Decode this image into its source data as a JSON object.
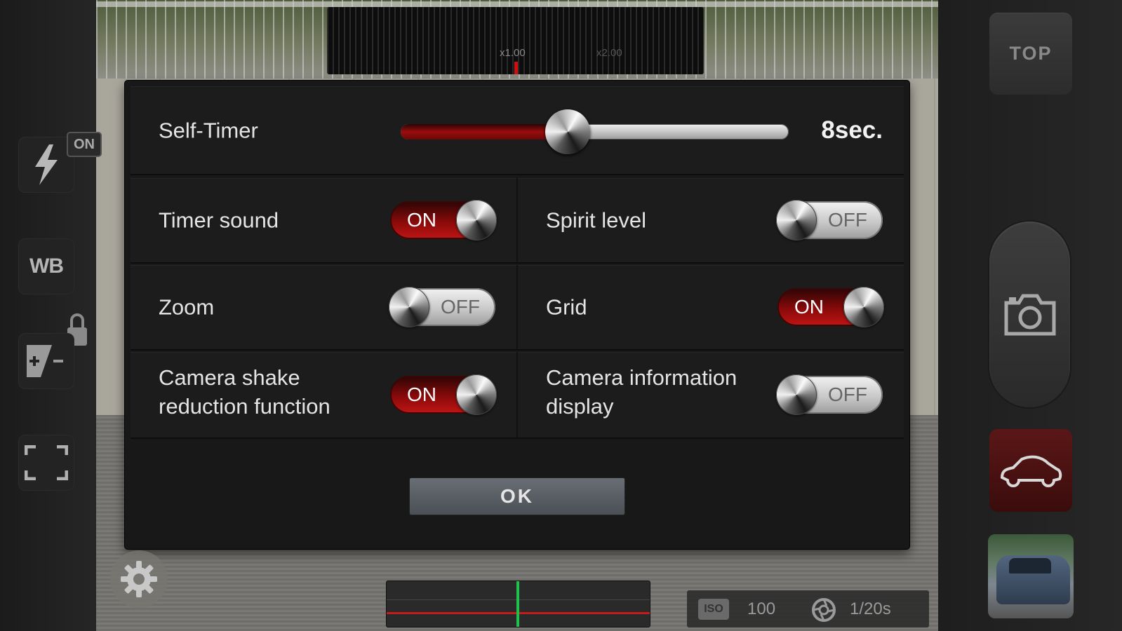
{
  "viewfinder": {
    "zoom_labels": [
      "x1.00",
      "x2.00"
    ]
  },
  "left_toolbar": {
    "flash_badge": "ON",
    "wb_label": "WB"
  },
  "right_toolbar": {
    "top_label": "TOP"
  },
  "settings": {
    "self_timer": {
      "label": "Self-Timer",
      "value_text": "8sec.",
      "level": 0.43
    },
    "toggles": [
      {
        "label": "Timer sound",
        "state": "ON"
      },
      {
        "label": "Spirit level",
        "state": "OFF"
      },
      {
        "label": "Zoom",
        "state": "OFF"
      },
      {
        "label": "Grid",
        "state": "ON"
      },
      {
        "label_line1": "Camera shake",
        "label_line2": "reduction function",
        "state": "ON"
      },
      {
        "label_line1": "Camera information",
        "label_line2": "display",
        "state": "OFF"
      }
    ],
    "ok_label": "OK"
  },
  "hud": {
    "iso_badge": "ISO",
    "iso_value": "100",
    "shutter_value": "1/20s"
  },
  "colors": {
    "accent_red": "#c01515",
    "level_green": "#1ec24a"
  }
}
